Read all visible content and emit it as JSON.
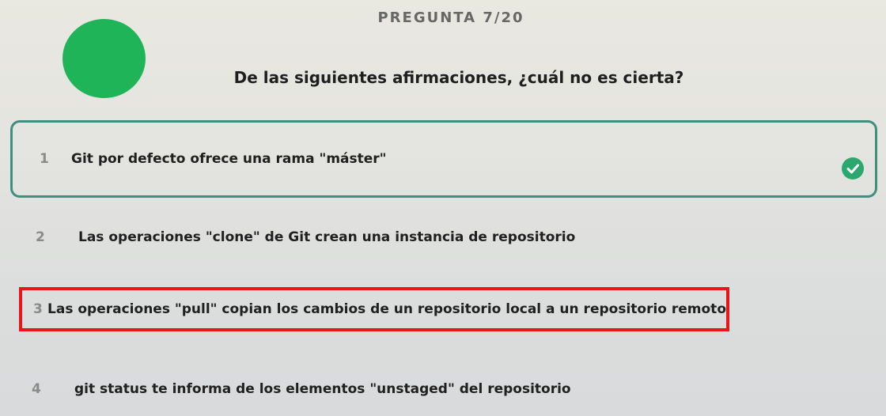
{
  "header": {
    "counter": "PREGUNTA 7/20"
  },
  "question": {
    "text": "De las siguientes afirmaciones, ¿cuál no es cierta?"
  },
  "options": [
    {
      "number": "1",
      "text": "Git por defecto ofrece una rama \"máster\"",
      "state": "selected-correct"
    },
    {
      "number": "2",
      "text": "Las operaciones \"clone\" de Git crean una instancia de repositorio"
    },
    {
      "number": "3",
      "text": "Las operaciones \"pull\" copian los cambios de un repositorio local a un repositorio remoto",
      "highlight": "red-box"
    },
    {
      "number": "4",
      "text": "git status te informa de los elementos \"unstaged\" del repositorio"
    }
  ],
  "colors": {
    "avatar": "#1fb457",
    "selected_border": "#3f8f7f",
    "check": "#2aa86d",
    "highlight_box": "#e8161b"
  },
  "icons": {
    "selected_indicator": "check-circle-icon"
  }
}
